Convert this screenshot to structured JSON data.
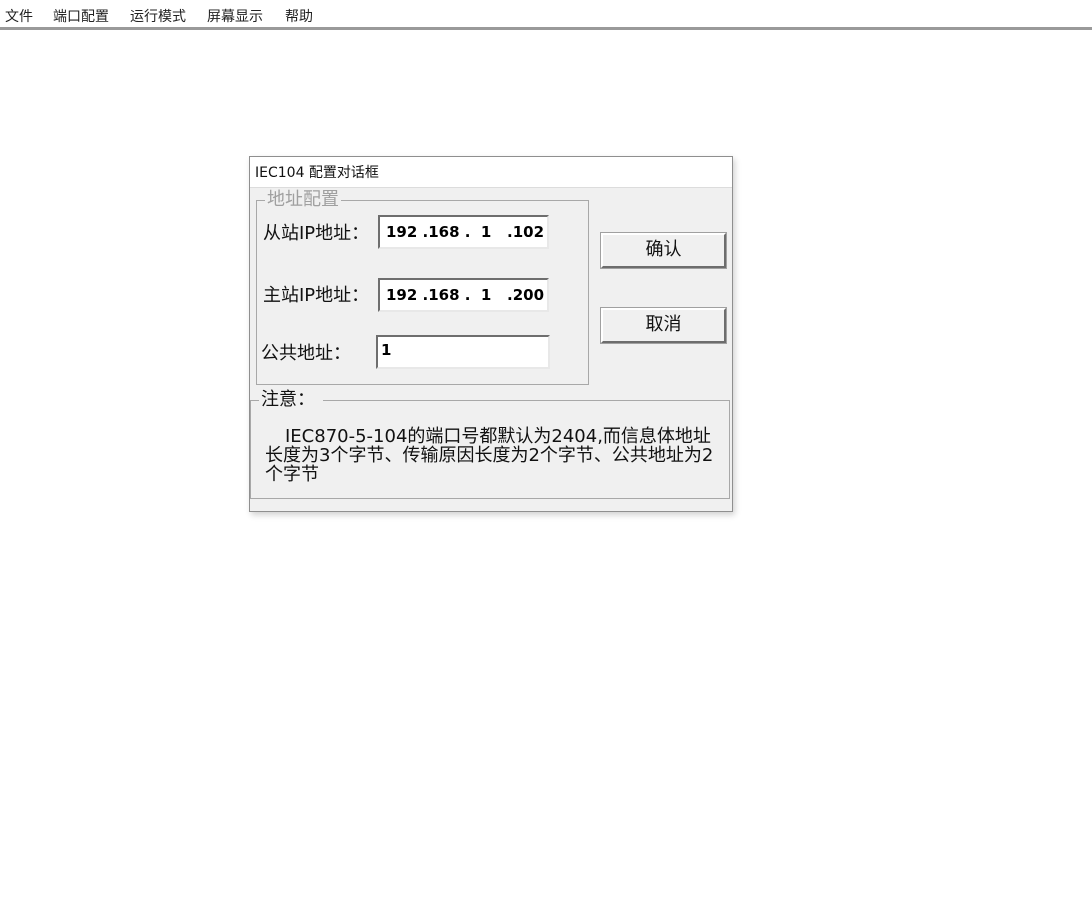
{
  "menubar": {
    "items": [
      "文件",
      "端口配置",
      "运行模式",
      "屏幕显示",
      "帮助"
    ]
  },
  "dialog": {
    "title": "IEC104 配置对话框",
    "address_group": {
      "legend": "地址配置",
      "slave_ip_label": "从站IP地址：",
      "slave_ip_value": "192 .168 .  1   .102",
      "master_ip_label": "主站IP地址：",
      "master_ip_value": "192 .168 .  1   .200",
      "common_addr_label": "公共地址：",
      "common_addr_value": "1"
    },
    "ok_button": "确认",
    "cancel_button": "取消",
    "note": {
      "legend": "注意：",
      "text": "IEC870-5-104的端口号都默认为2404,而信息体地址长度为3个字节、传输原因长度为2个字节、公共地址为2个字节"
    }
  }
}
